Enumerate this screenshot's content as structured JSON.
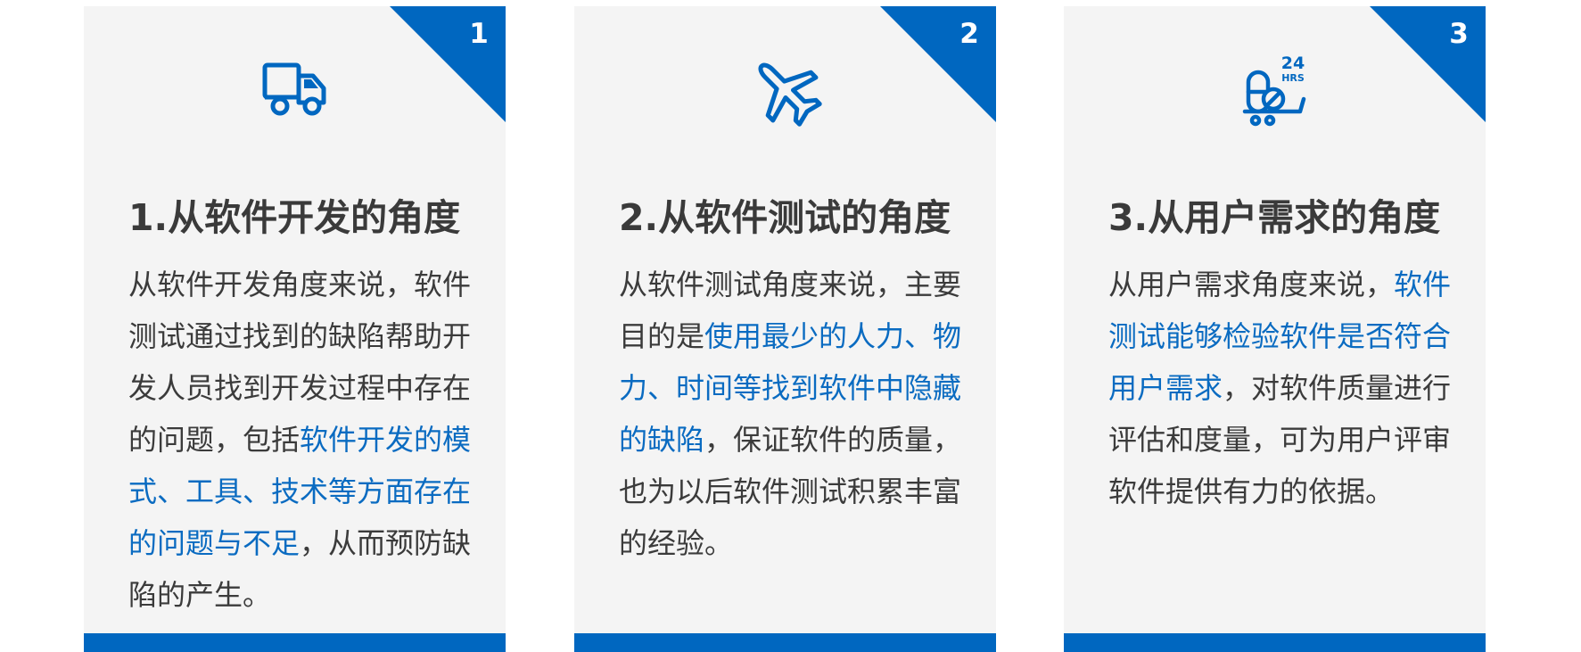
{
  "colors": {
    "accent": "#0067c0",
    "card_bg": "#f4f4f4",
    "text": "#3b3b3b",
    "highlight": "#0a6bc1"
  },
  "cards": [
    {
      "number": "1",
      "icon": "truck-icon",
      "title": "1.从软件开发的角度",
      "body": {
        "pre": "从软件开发角度来说，软件测试通过找到的缺陷帮助开发人员找到开发过程中存在的问题，包括",
        "highlight": "软件开发的模式、工具、技术等方面存在的问题与不足",
        "post": "，从而预防缺陷的产生。"
      }
    },
    {
      "number": "2",
      "icon": "airplane-icon",
      "title": "2.从软件测试的角度",
      "body": {
        "pre": "从软件测试角度来说，主要目的是",
        "highlight": "使用最少的人力、物力、时间等找到软件中隐藏的缺陷",
        "post": "，保证软件的质量，也为以后软件测试积累丰富的经验。"
      }
    },
    {
      "number": "3",
      "icon": "24hrs-pharmacy-cart-icon",
      "icon_text": {
        "hours": "24",
        "unit": "HRS"
      },
      "title": "3.从用户需求的角度",
      "body": {
        "pre": "从用户需求角度来说，",
        "highlight": "软件测试能够检验软件是否符合用户需求",
        "post": "，对软件质量进行评估和度量，可为用户评审软件提供有力的依据。"
      }
    }
  ]
}
